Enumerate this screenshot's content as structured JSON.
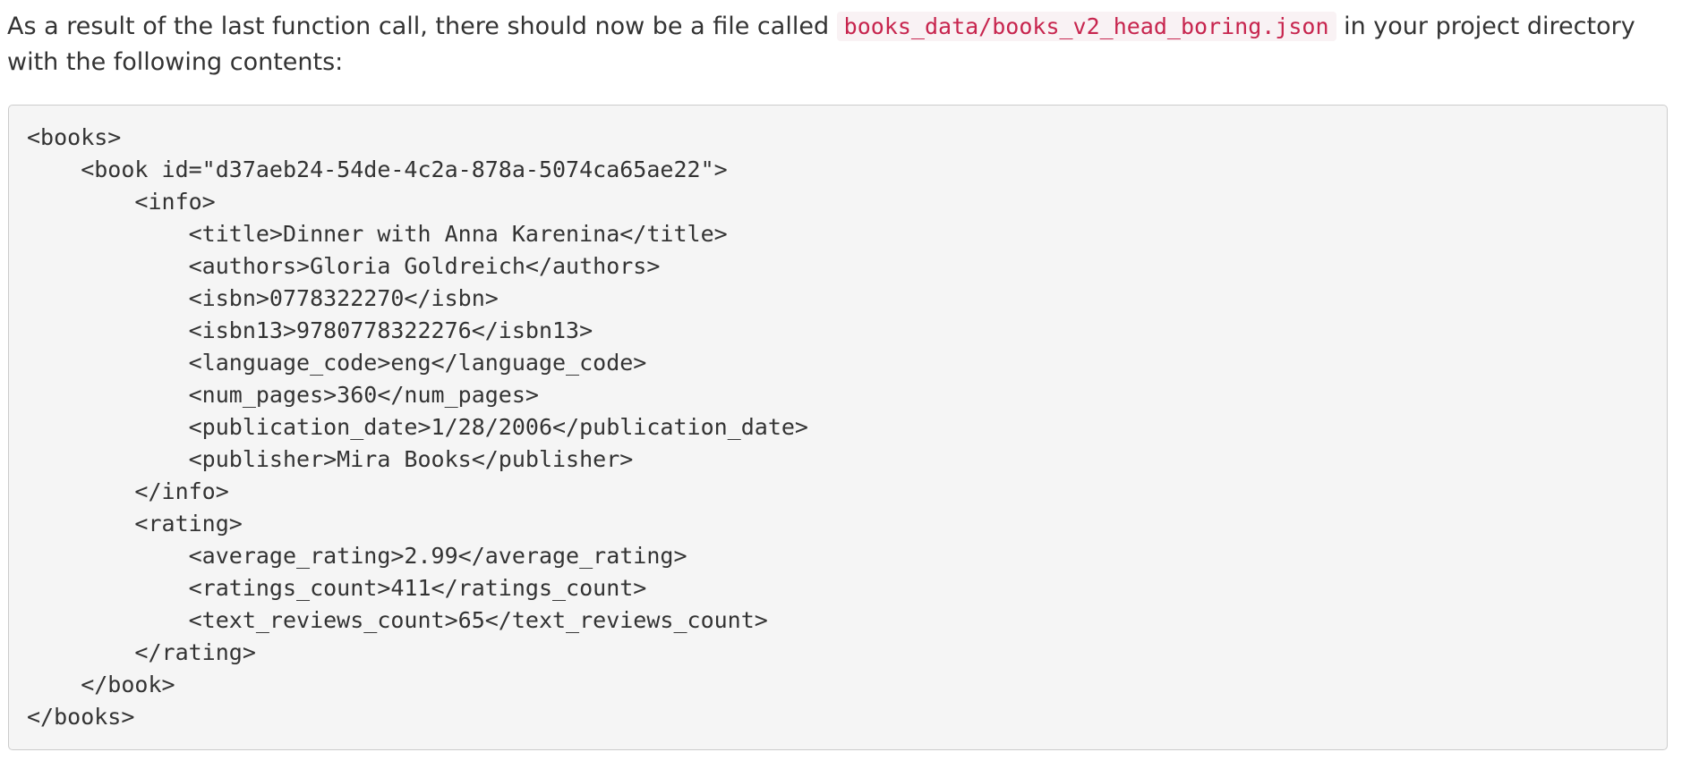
{
  "intro": {
    "text_before": "As a result of the last function call, there should now be a file called ",
    "filename": "books_data/books_v2_head_boring.json",
    "text_after": " in your project directory with the following contents:"
  },
  "code": {
    "lines": [
      "<books>",
      "    <book id=\"d37aeb24-54de-4c2a-878a-5074ca65ae22\">",
      "        <info>",
      "            <title>Dinner with Anna Karenina</title>",
      "            <authors>Gloria Goldreich</authors>",
      "            <isbn>0778322270</isbn>",
      "            <isbn13>9780778322276</isbn13>",
      "            <language_code>eng</language_code>",
      "            <num_pages>360</num_pages>",
      "            <publication_date>1/28/2006</publication_date>",
      "            <publisher>Mira Books</publisher>",
      "        </info>",
      "        <rating>",
      "            <average_rating>2.99</average_rating>",
      "            <ratings_count>411</ratings_count>",
      "            <text_reviews_count>65</text_reviews_count>",
      "        </rating>",
      "    </book>",
      "</books>"
    ]
  }
}
